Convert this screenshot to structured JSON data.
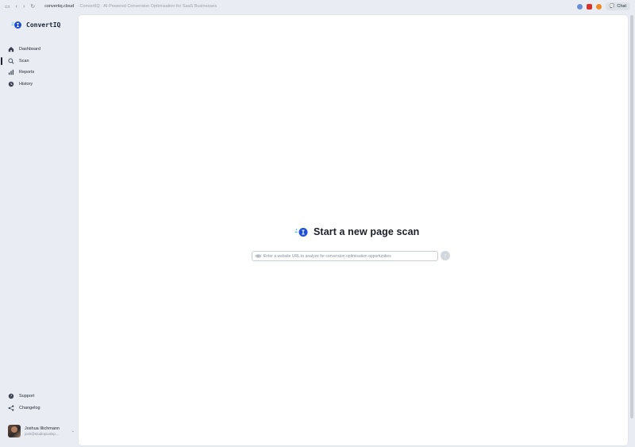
{
  "browser": {
    "host": "convertiq.cloud",
    "path": "· ConvertIQ · AI-Powered Conversion Optimisation for SaaS Businesses",
    "chat_label": "Chat"
  },
  "sidebar": {
    "brand": "ConvertIQ",
    "items": [
      {
        "label": "Dashboard",
        "icon": "home-icon"
      },
      {
        "label": "Scan",
        "icon": "search-icon"
      },
      {
        "label": "Reports",
        "icon": "bar-chart-icon"
      },
      {
        "label": "History",
        "icon": "clock-icon"
      }
    ],
    "bottom_items": [
      {
        "label": "Support",
        "icon": "help-icon"
      },
      {
        "label": "Changelog",
        "icon": "share-icon"
      }
    ],
    "user": {
      "name": "Joshua Illichmann",
      "email": "josh@studiopixelsp..."
    }
  },
  "main": {
    "title": "Start a new page scan",
    "search_placeholder": "Enter a website URL to analyze for conversion optimisation opportunities"
  },
  "colors": {
    "brand_blue": "#1d4ed8",
    "accent_cyan": "#38bdf8",
    "background": "#e9ecf2"
  }
}
